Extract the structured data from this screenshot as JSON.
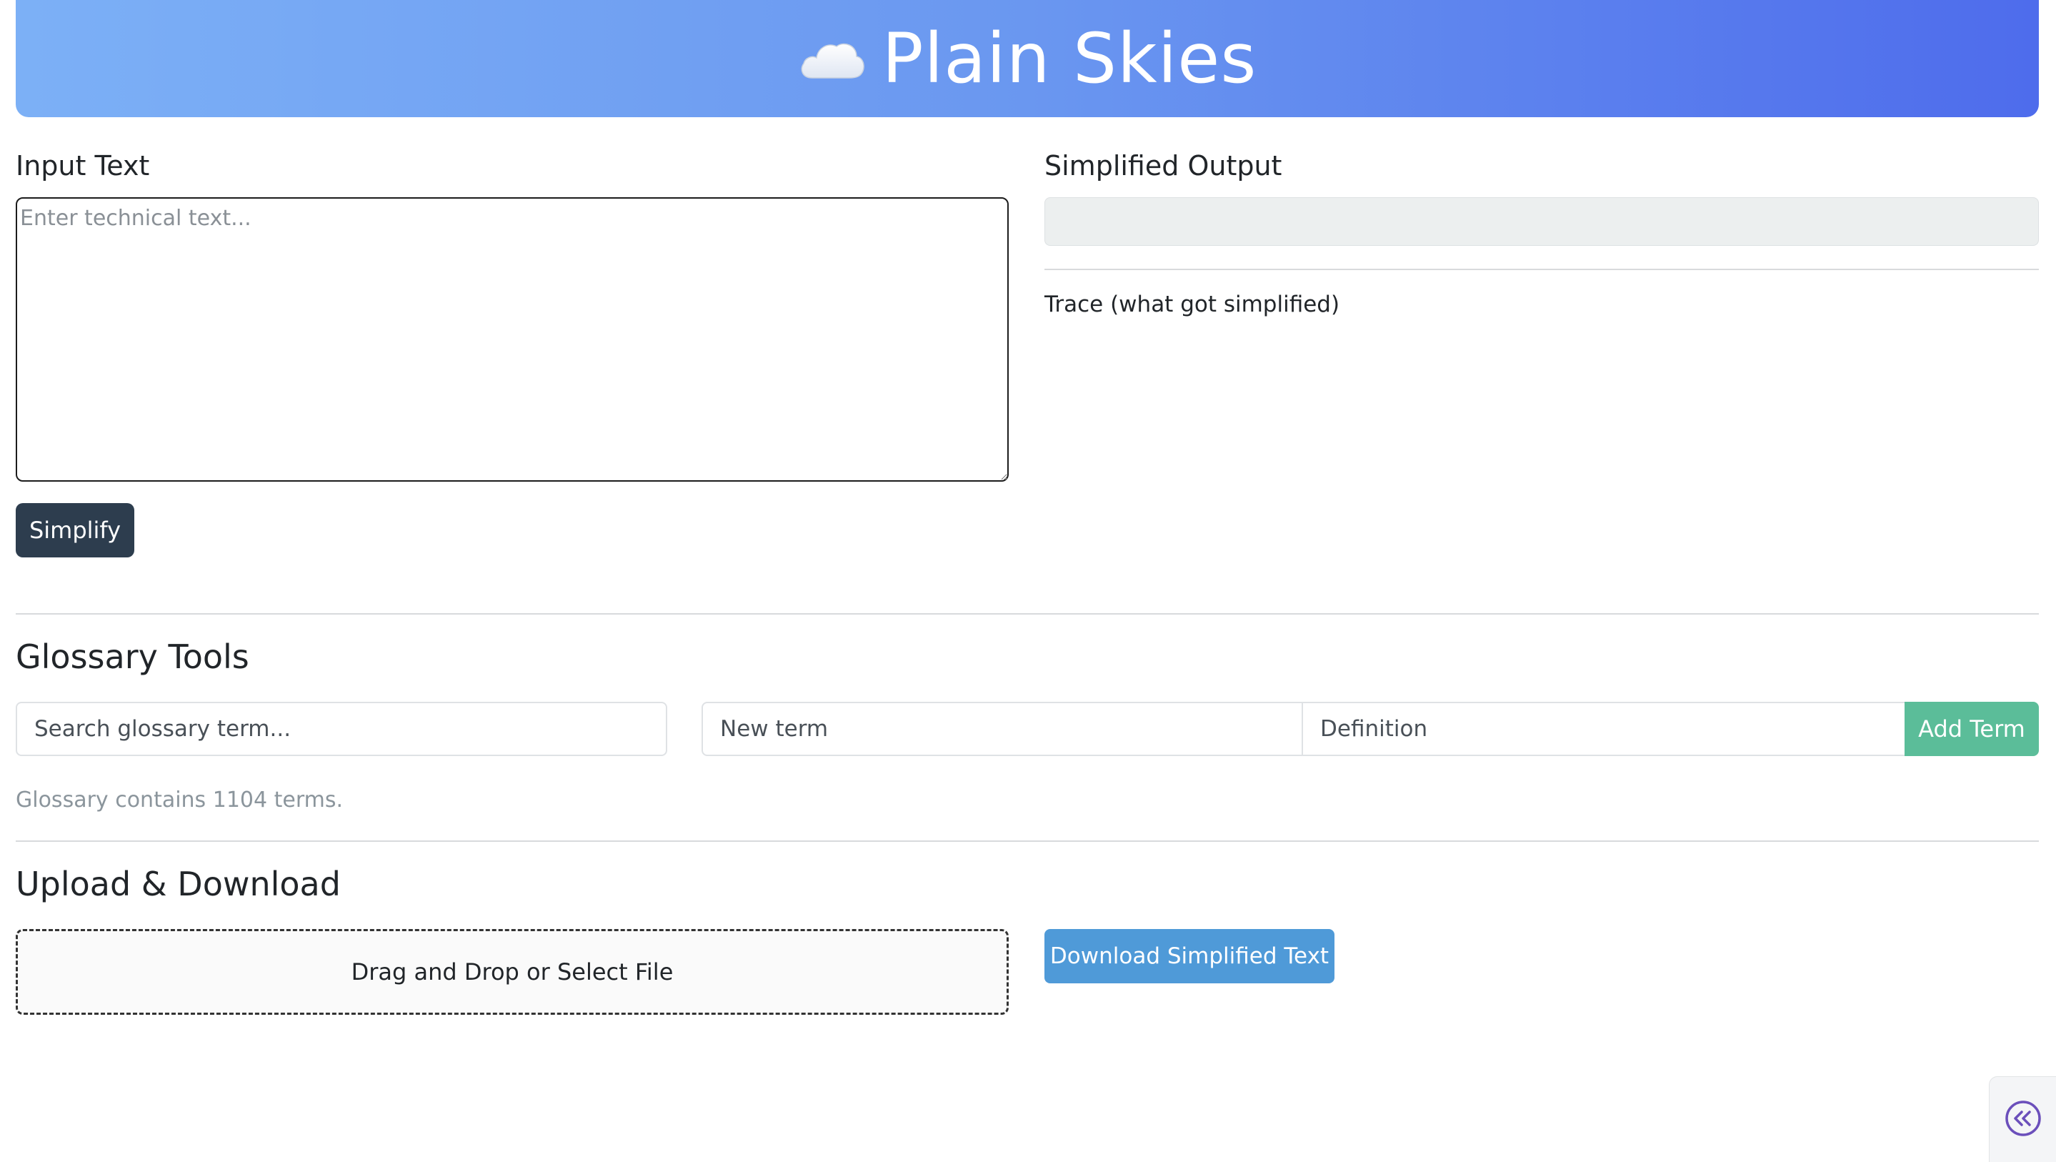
{
  "header": {
    "icon": "cloud-icon",
    "title": "Plain Skies"
  },
  "input": {
    "label": "Input Text",
    "placeholder": "Enter technical text...",
    "value": "",
    "simplify_button": "Simplify"
  },
  "output": {
    "label": "Simplified Output",
    "value": "",
    "trace_label": "Trace (what got simplified)"
  },
  "glossary": {
    "heading": "Glossary Tools",
    "search_placeholder": "Search glossary term...",
    "new_term_placeholder": "New term",
    "definition_placeholder": "Definition",
    "add_button": "Add Term",
    "status": "Glossary contains 1104 terms."
  },
  "upload": {
    "heading": "Upload & Download",
    "dropzone_text": "Drag and Drop or Select File",
    "download_button": "Download Simplified Text"
  },
  "corner": {
    "icon": "double-chevron-left-icon"
  },
  "colors": {
    "header_gradient_start": "#7cb0f6",
    "header_gradient_end": "#4e6cec",
    "simplify_button": "#2d3d4e",
    "add_button": "#5bbd99",
    "download_button": "#4f9ad8",
    "corner_icon": "#6b4fbb"
  }
}
